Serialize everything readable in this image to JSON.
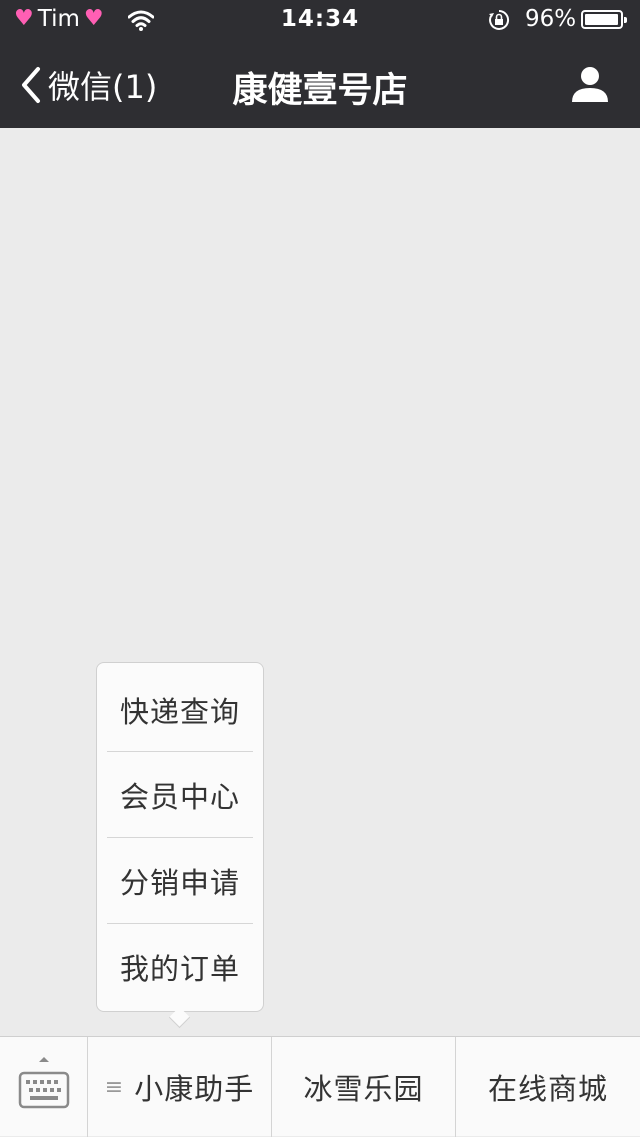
{
  "status_bar": {
    "carrier": "Tim",
    "time": "14:34",
    "battery": "96%",
    "battery_level": 0.96
  },
  "nav": {
    "back_label": "微信(1)",
    "title": "康健壹号店"
  },
  "popup_menu": {
    "items": [
      "快递查询",
      "会员中心",
      "分销申请",
      "我的订单"
    ]
  },
  "bottom_menu": {
    "items": [
      "小康助手",
      "冰雪乐园",
      "在线商城"
    ]
  },
  "colors": {
    "nav_bg": "#2e2e32",
    "page_bg": "#ebebeb",
    "heart": "#ff5fb4"
  }
}
